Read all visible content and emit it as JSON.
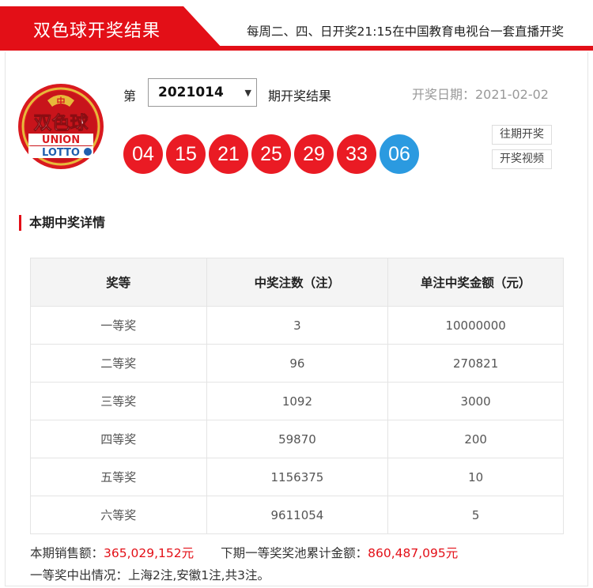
{
  "header": {
    "title": "双色球开奖结果",
    "notice": "每周二、四、日开奖21:15在中国教育电视台一套直播开奖"
  },
  "logo": {
    "cn_text": "双色球",
    "en_line1": "UNION",
    "en_line2": "LOTTO",
    "colors": {
      "ring": "#d9191f",
      "gold": "#e7b93a",
      "blue": "#1f5fae"
    }
  },
  "issue": {
    "prefix": "第",
    "selected": "2021014",
    "suffix": "期开奖结果"
  },
  "draw_date": "开奖日期：2021-02-02",
  "balls": {
    "red": [
      "04",
      "15",
      "21",
      "25",
      "29",
      "33"
    ],
    "blue": [
      "06"
    ],
    "colors": {
      "red": "#ea1b24",
      "blue": "#2b9ae0"
    }
  },
  "buttons": {
    "history": "往期开奖",
    "video": "开奖视频"
  },
  "section_title": "本期中奖详情",
  "table": {
    "headers": [
      "奖等",
      "中奖注数（注）",
      "单注中奖金额（元）"
    ],
    "rows": [
      [
        "一等奖",
        "3",
        "10000000"
      ],
      [
        "二等奖",
        "96",
        "270821"
      ],
      [
        "三等奖",
        "1092",
        "3000"
      ],
      [
        "四等奖",
        "59870",
        "200"
      ],
      [
        "五等奖",
        "1156375",
        "10"
      ],
      [
        "六等奖",
        "9611054",
        "5"
      ]
    ]
  },
  "summary": {
    "sales_label": "本期销售额：",
    "sales_value": "365,029,152元",
    "pool_label": "下期一等奖奖池累计金额：",
    "pool_value": "860,487,095元",
    "winners": "一等奖中出情况：上海2注,安徽1注,共3注。"
  },
  "accent_color": "#e30f17"
}
